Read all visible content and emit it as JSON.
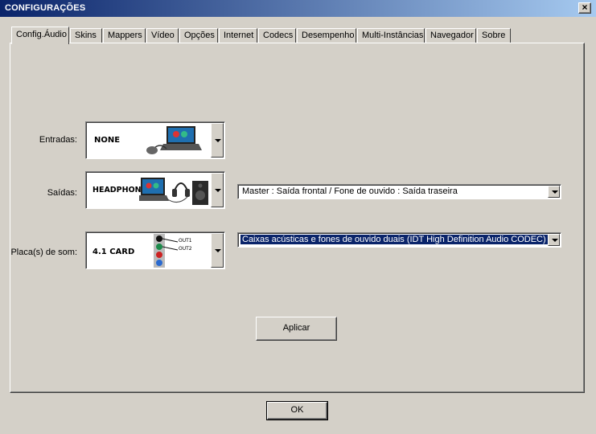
{
  "window": {
    "title": "CONFIGURAÇÕES"
  },
  "tabs": [
    {
      "label": "Config.Áudio"
    },
    {
      "label": "Skins"
    },
    {
      "label": "Mappers"
    },
    {
      "label": "Vídeo"
    },
    {
      "label": "Opções"
    },
    {
      "label": "Internet"
    },
    {
      "label": "Codecs"
    },
    {
      "label": "Desempenho"
    },
    {
      "label": "Multi-Instâncias"
    },
    {
      "label": "Navegador"
    },
    {
      "label": "Sobre"
    }
  ],
  "audio": {
    "inputs": {
      "label": "Entradas:",
      "value": "NONE"
    },
    "outputs": {
      "label": "Saídas:",
      "value": "HEADPHONES",
      "routing": "Master : Saída frontal / Fone de ouvido : Saída traseira"
    },
    "soundcard": {
      "label": "Placa(s) de som:",
      "value": "4.1 CARD",
      "out1": "OUT1",
      "out2": "OUT2",
      "device": "Caixas acústicas e fones de ouvido duais (IDT High Definition Audio CODEC)"
    },
    "apply_label": "Aplicar"
  },
  "ok_label": "OK"
}
